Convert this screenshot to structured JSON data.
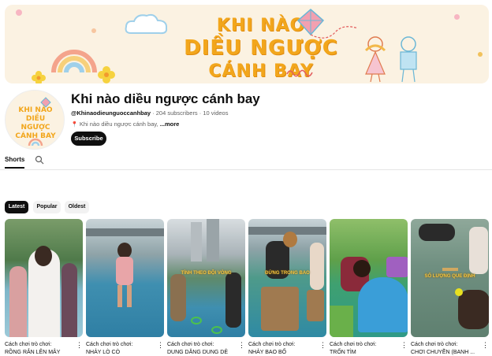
{
  "banner": {
    "title_line1": "KHI NÀO",
    "title_line2": "DIỀU NGƯỢC",
    "title_line3": "CÁNH BAY"
  },
  "avatar": {
    "text_line1": "KHI NÀO",
    "text_line2": "DIỀU NGƯỢC",
    "text_line3": "CÁNH BAY"
  },
  "channel": {
    "name": "Khi nào diều ngược cánh bay",
    "handle": "@Khinaodieunguoccanhbay",
    "stats": " · 204 subscribers · 10 videos",
    "description": "Khi nào diều ngược cánh bay, ",
    "more_label": "...more",
    "subscribe_label": "Subscribe"
  },
  "tabs": {
    "shorts_label": "Shorts"
  },
  "chips": {
    "latest": "Latest",
    "popular": "Popular",
    "oldest": "Oldest"
  },
  "shorts": [
    {
      "line1": "Cách chơi trò chơi:",
      "line2": "RỒNG RẮN LÊN MÂY",
      "overlay": ""
    },
    {
      "line1": "Cách chơi trò chơi:",
      "line2": "NHẢY LÒ CÒ",
      "overlay": ""
    },
    {
      "line1": "Cách chơi trò chơi:",
      "line2": "DUNG DĂNG DUNG DẺ",
      "overlay": "TÍNH THEO ĐỘI VÒNG"
    },
    {
      "line1": "Cách chơi trò chơi:",
      "line2": "NHẢY BAO BỐ",
      "overlay": "ĐỨNG TRONG BAO"
    },
    {
      "line1": "Cách chơi trò chơi:",
      "line2": "TRỐN TÌM",
      "overlay": ""
    },
    {
      "line1": "Cách chơi trò chơi:",
      "line2": "CHƠI CHUYỀN (BANH ...",
      "overlay": "SỐ LƯỢNG QUE ĐỊNH"
    }
  ],
  "more_icon": "⋮",
  "colors": {
    "accent": "#f2a61c",
    "banner_bg": "#fbf2e2"
  }
}
